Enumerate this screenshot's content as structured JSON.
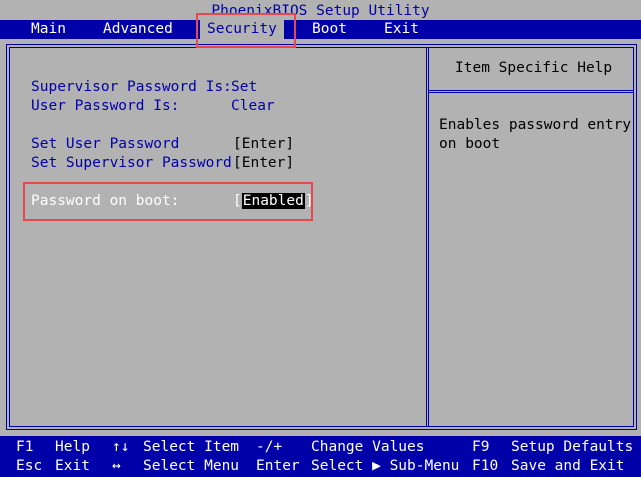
{
  "title": "PhoenixBIOS Setup Utility",
  "menu": {
    "items": [
      {
        "label": "Main"
      },
      {
        "label": "Advanced"
      },
      {
        "label": "Security",
        "active": true
      },
      {
        "label": "Boot"
      },
      {
        "label": "Exit"
      }
    ]
  },
  "security": {
    "supervisor_status_label": "Supervisor Password Is:",
    "supervisor_status_value": "Set",
    "user_status_label": "User Password Is:",
    "user_status_value": "Clear",
    "set_user_label": "Set User Password",
    "set_user_value": "[Enter]",
    "set_supervisor_label": "Set Supervisor Password",
    "set_supervisor_value": "[Enter]",
    "boot_password_label": "Password on boot:",
    "boot_password_value": "Enabled"
  },
  "help": {
    "header": "Item Specific Help",
    "line1": "Enables password entry",
    "line2": "on boot"
  },
  "footer": {
    "row1": [
      {
        "key": "F1",
        "desc": "Help"
      },
      {
        "key": "↑↓",
        "desc": "Select Item"
      },
      {
        "key": "-/+",
        "desc": "Change Values"
      },
      {
        "key": "F9",
        "desc": "Setup Defaults"
      }
    ],
    "row2": [
      {
        "key": "Esc",
        "desc": "Exit"
      },
      {
        "key": "↔",
        "desc": "Select Menu"
      },
      {
        "key": "Enter",
        "desc": "Select ▶ Sub-Menu"
      },
      {
        "key": "F10",
        "desc": "Save and Exit"
      }
    ]
  },
  "colors": {
    "background": "#b2b2b2",
    "bios_blue": "#0000a8",
    "annotation_red": "#e8474d"
  }
}
